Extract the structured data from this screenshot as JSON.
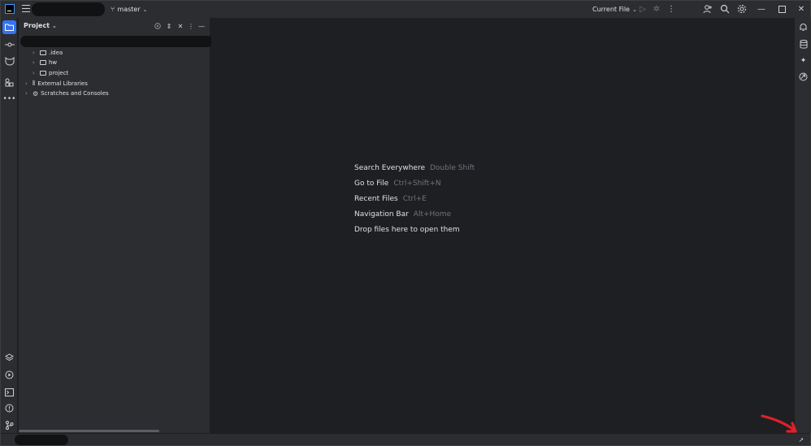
{
  "titlebar": {
    "branch": "master",
    "run_config": "Current File"
  },
  "panel": {
    "title": "Project"
  },
  "tree": [
    {
      "label": ".idea",
      "kind": "folder"
    },
    {
      "label": "hw",
      "kind": "folder"
    },
    {
      "label": "project",
      "kind": "folder"
    },
    {
      "label": "External Libraries",
      "kind": "library"
    },
    {
      "label": "Scratches and Consoles",
      "kind": "scratches"
    }
  ],
  "hints": [
    {
      "label": "Search Everywhere",
      "shortcut": "Double Shift"
    },
    {
      "label": "Go to File",
      "shortcut": "Ctrl+Shift+N"
    },
    {
      "label": "Recent Files",
      "shortcut": "Ctrl+E"
    },
    {
      "label": "Navigation Bar",
      "shortcut": "Alt+Home"
    },
    {
      "label": "Drop files here to open them",
      "shortcut": ""
    }
  ],
  "colors": {
    "accent": "#3574f0",
    "annotation": "#e0202a"
  },
  "icons": {
    "left_top": [
      "project-folder-icon",
      "commit-icon",
      "pull-requests-icon",
      "structure-icon",
      "more-tools-icon"
    ],
    "left_bottom": [
      "layers-icon",
      "services-icon",
      "terminal-icon",
      "problems-icon",
      "git-icon"
    ],
    "right": [
      "notifications-icon",
      "database-icon",
      "ai-assistant-icon",
      "endpoints-icon"
    ]
  }
}
